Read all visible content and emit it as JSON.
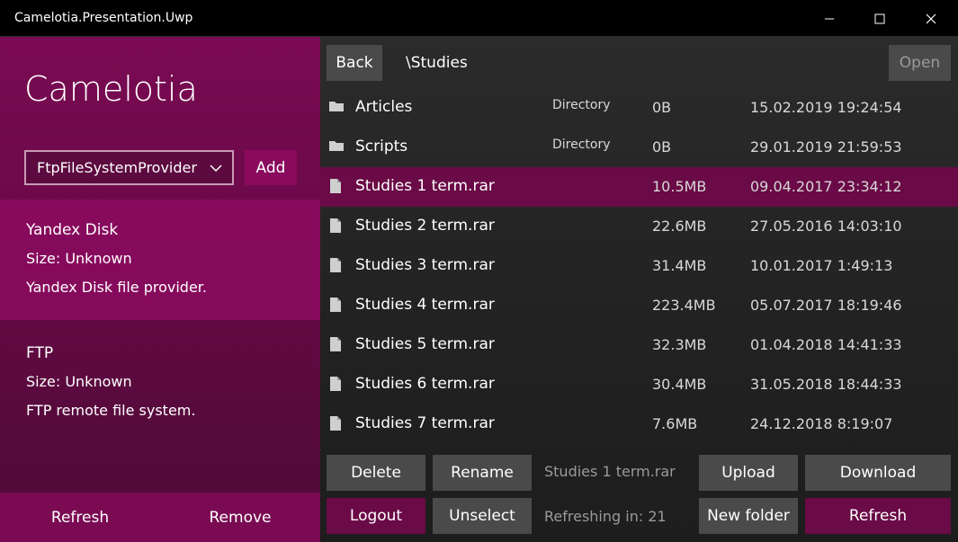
{
  "window": {
    "title": "Camelotia.Presentation.Uwp"
  },
  "left": {
    "app_title": "Camelotia",
    "provider_select": "FtpFileSystemProvider",
    "add_label": "Add",
    "providers": [
      {
        "name": "Yandex Disk",
        "size": "Size: Unknown",
        "description": "Yandex Disk file provider."
      },
      {
        "name": "FTP",
        "size": "Size: Unknown",
        "description": "FTP remote file system."
      }
    ],
    "refresh_label": "Refresh",
    "remove_label": "Remove"
  },
  "right": {
    "back_label": "Back",
    "path": "\\Studies",
    "open_label": "Open",
    "files": [
      {
        "name": "Articles",
        "type": "Directory",
        "size": "0B",
        "date": "15.02.2019 19:24:54",
        "icon": "folder-icon"
      },
      {
        "name": "Scripts",
        "type": "Directory",
        "size": "0B",
        "date": "29.01.2019 21:59:53",
        "icon": "folder-icon"
      },
      {
        "name": "Studies 1 term.rar",
        "type": "",
        "size": "10.5MB",
        "date": "09.04.2017 23:34:12",
        "icon": "file-icon"
      },
      {
        "name": "Studies 2 term.rar",
        "type": "",
        "size": "22.6MB",
        "date": "27.05.2016 14:03:10",
        "icon": "file-icon"
      },
      {
        "name": "Studies 3 term.rar",
        "type": "",
        "size": "31.4MB",
        "date": "10.01.2017 1:49:13",
        "icon": "file-icon"
      },
      {
        "name": "Studies 4 term.rar",
        "type": "",
        "size": "223.4MB",
        "date": "05.07.2017 18:19:46",
        "icon": "file-icon"
      },
      {
        "name": "Studies 5 term.rar",
        "type": "",
        "size": "32.3MB",
        "date": "01.04.2018 14:41:33",
        "icon": "file-icon"
      },
      {
        "name": "Studies 6 term.rar",
        "type": "",
        "size": "30.4MB",
        "date": "31.05.2018 18:44:33",
        "icon": "file-icon"
      },
      {
        "name": "Studies 7 term.rar",
        "type": "",
        "size": "7.6MB",
        "date": "24.12.2018 8:19:07",
        "icon": "file-icon"
      }
    ],
    "selected_file": "Studies 1 term.rar",
    "delete_label": "Delete",
    "rename_label": "Rename",
    "upload_label": "Upload",
    "download_label": "Download",
    "logout_label": "Logout",
    "unselect_label": "Unselect",
    "refreshing_label": "Refreshing in: 21",
    "new_folder_label": "New folder",
    "refresh_label": "Refresh"
  },
  "colors": {
    "accent": "#7a0a52",
    "selection": "#6a0a46",
    "button": "#4a4a4a"
  }
}
